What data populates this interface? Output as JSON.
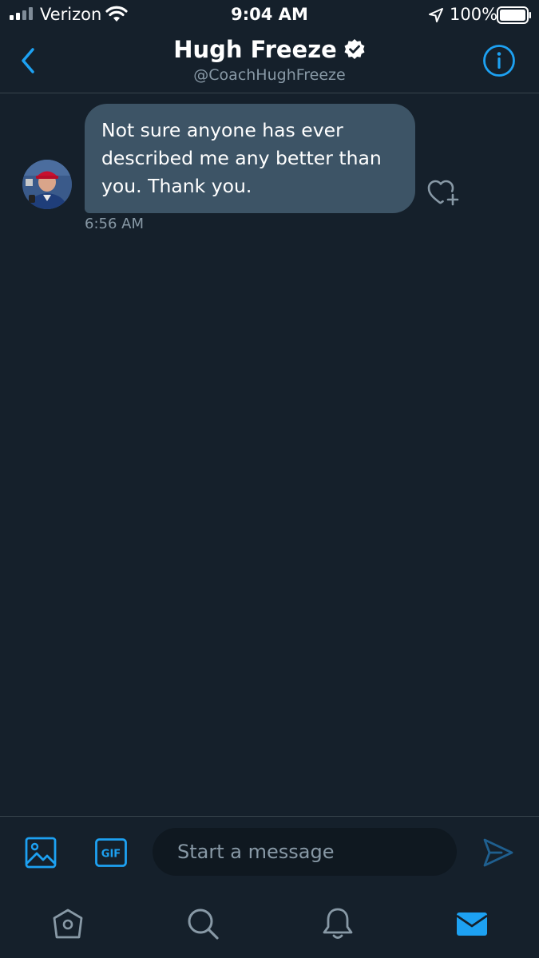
{
  "status_bar": {
    "carrier": "Verizon",
    "time": "9:04 AM",
    "battery": "100%",
    "icons": [
      "signal-icon",
      "wifi-icon",
      "location-arrow-icon",
      "battery-icon"
    ]
  },
  "header": {
    "name": "Hugh Freeze",
    "handle": "@CoachHughFreeze",
    "verified": true,
    "icons": [
      "back-chevron-icon",
      "verified-badge-icon",
      "info-icon"
    ]
  },
  "messages": [
    {
      "text": "Not sure anyone has ever described me any better than you. Thank you.",
      "time": "6:56 AM",
      "direction": "incoming"
    }
  ],
  "composer": {
    "placeholder": "Start a message",
    "gif_label": "GIF",
    "icons": [
      "image-icon",
      "gif-icon",
      "send-icon"
    ]
  },
  "tab_bar": {
    "tabs": [
      "home",
      "search",
      "notifications",
      "messages"
    ],
    "active": "messages"
  },
  "colors": {
    "background": "#15202b",
    "accent": "#1da1f2",
    "bubble": "#3d5466",
    "secondary_text": "#8899a6",
    "divider": "#38444d"
  }
}
